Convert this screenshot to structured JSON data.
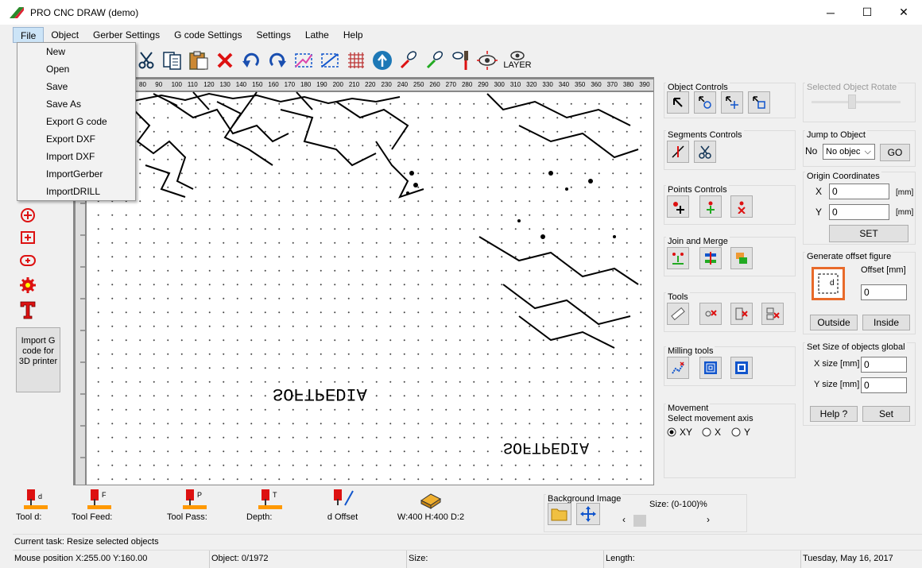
{
  "window": {
    "title": "PRO CNC DRAW (demo)"
  },
  "menu": {
    "items": [
      "File",
      "Object",
      "Gerber Settings",
      "G code Settings",
      "Settings",
      "Lathe",
      "Help"
    ]
  },
  "file_menu": {
    "items": [
      "New",
      "Open",
      "Save",
      "Save As",
      "Export G code",
      "Export DXF",
      "Import DXF",
      "ImportGerber",
      "ImportDRILL"
    ]
  },
  "toolbar": {
    "layer_label": "LAYER"
  },
  "left_panel": {
    "import_label": "Import G code for 3D printer"
  },
  "canvas": {
    "ruler_labels": [
      "80",
      "90",
      "100",
      "110",
      "120",
      "130",
      "140",
      "150",
      "160",
      "170",
      "180",
      "190",
      "200",
      "210",
      "220",
      "230",
      "240",
      "250",
      "260",
      "270",
      "280",
      "290",
      "300",
      "310",
      "320",
      "330",
      "340",
      "350",
      "360",
      "370",
      "380",
      "390"
    ],
    "text1": "SOFTPEDIA",
    "text2": "SOFTPEDIA"
  },
  "right_panel": {
    "object_controls": "Object Controls",
    "segments_controls": "Segments Controls",
    "points_controls": "Points Controls",
    "join_merge": "Join and Merge",
    "tools": "Tools",
    "milling_tools": "Milling tools",
    "movement": "Movement",
    "movement_axis_label": "Select movement axis",
    "axis_options": [
      "XY",
      "X",
      "Y"
    ],
    "selected_object_rotate": "Selected Object Rotate",
    "jump_to_object": "Jump to Object",
    "no_label": "No",
    "no_select_value": "No objec",
    "go_button": "GO",
    "origin_coordinates": "Origin Coordinates",
    "x_label": "X",
    "y_label": "Y",
    "x_value": "0",
    "y_value": "0",
    "mm_unit": "[mm]",
    "set_button": "SET",
    "generate_offset": "Generate offset figure",
    "offset_label": "Offset [mm]",
    "offset_value": "0",
    "outside_button": "Outside",
    "inside_button": "Inside",
    "set_size_global": "Set Size of objects global",
    "x_size_label": "X size [mm]",
    "y_size_label": "Y size [mm]",
    "x_size_value": "0",
    "y_size_value": "0",
    "help_button": "Help ?",
    "set2_button": "Set"
  },
  "bottom": {
    "tool_d": "Tool d:",
    "tool_feed": "Tool Feed:",
    "tool_pass": "Tool Pass:",
    "depth": "Depth:",
    "d_offset": "d Offset",
    "dims": "W:400 H:400 D:2",
    "background_image": "Background Image",
    "size_label": "Size: (0-100)%"
  },
  "status": {
    "current_task": "Current task: Resize selected objects",
    "mouse_position": "Mouse position X:255.00 Y:160.00",
    "object": "Object: 0/1972",
    "size": "Size:",
    "length": "Length:",
    "date": "Tuesday, May 16, 2017"
  }
}
